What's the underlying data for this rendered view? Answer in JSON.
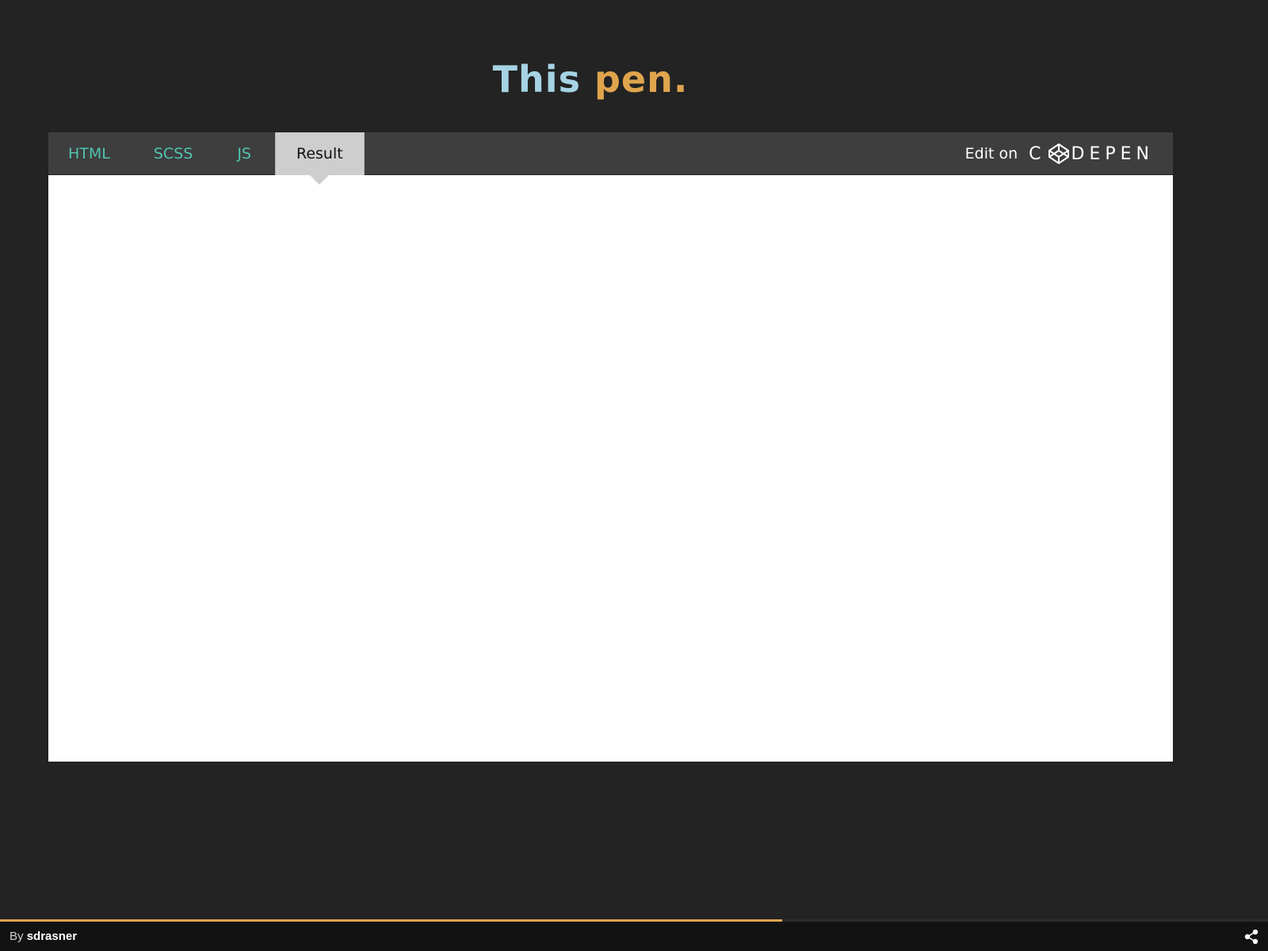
{
  "title": {
    "part1": "This",
    "part2": "pen."
  },
  "tabs": [
    {
      "label": "HTML",
      "active": false
    },
    {
      "label": "SCSS",
      "active": false
    },
    {
      "label": "JS",
      "active": false
    },
    {
      "label": "Result",
      "active": true
    }
  ],
  "edit_on": {
    "label": "Edit on",
    "brand_left": "C",
    "brand_right": "DEPEN"
  },
  "footer": {
    "by_label": "By",
    "author": "sdrasner",
    "progress": 0.617
  },
  "icons": {
    "logo": "codepen-box-icon",
    "share": "share-icon"
  },
  "colors": {
    "title_part1": "#a6d3e4",
    "title_part2": "#e0a44d",
    "tab_text": "#4fc4b0",
    "active_tab_bg": "#cecece",
    "progress": "#e0a44d"
  }
}
